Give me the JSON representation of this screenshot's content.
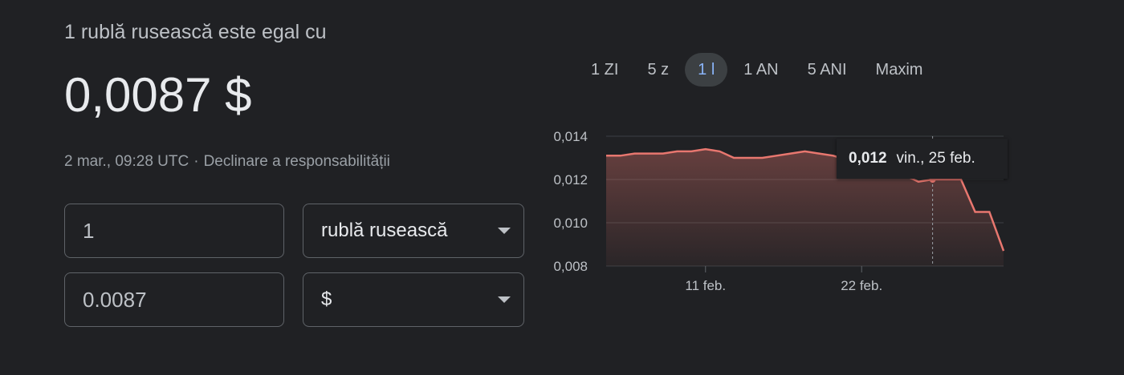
{
  "header": {
    "subtitle": "1 rublă rusească este egal cu",
    "rate": "0,0087 $",
    "timestamp": "2 mar., 09:28 UTC",
    "separator": "·",
    "disclaimer": "Declinare a responsabilității"
  },
  "converter": {
    "from_amount": "1",
    "from_currency": "rublă rusească",
    "to_amount": "0.0087",
    "to_currency": "$"
  },
  "tabs": [
    "1 ZI",
    "5 z",
    "1 l",
    "1 AN",
    "5 ANI",
    "Maxim"
  ],
  "active_tab": "1 l",
  "tooltip": {
    "value": "0,012",
    "date": "vin., 25 feb."
  },
  "chart_data": {
    "type": "area",
    "y_ticks": [
      "0,014",
      "0,012",
      "0,010",
      "0,008"
    ],
    "y_tick_values": [
      0.014,
      0.012,
      0.01,
      0.008
    ],
    "ylim": [
      0.008,
      0.014
    ],
    "x_tick_labels": [
      "11 feb.",
      "22 feb."
    ],
    "x_tick_positions": [
      7,
      18
    ],
    "xlim": [
      0,
      28
    ],
    "x": [
      0,
      1,
      2,
      3,
      4,
      5,
      6,
      7,
      8,
      9,
      10,
      11,
      12,
      13,
      14,
      15,
      16,
      17,
      18,
      19,
      20,
      21,
      22,
      23,
      24,
      25,
      26,
      27,
      28
    ],
    "values": [
      0.0131,
      0.0131,
      0.0132,
      0.0132,
      0.0132,
      0.0133,
      0.0133,
      0.0134,
      0.0133,
      0.013,
      0.013,
      0.013,
      0.0131,
      0.0132,
      0.0133,
      0.0132,
      0.0131,
      0.0129,
      0.0128,
      0.0127,
      0.0124,
      0.0122,
      0.0119,
      0.012,
      0.012,
      0.012,
      0.0105,
      0.0105,
      0.0087
    ],
    "highlight_index": 23,
    "line_color": "#e8776f",
    "grid": true
  }
}
